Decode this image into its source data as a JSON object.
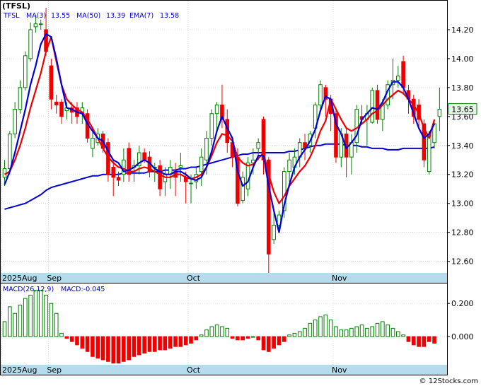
{
  "chart_data": [
    {
      "type": "candlestick",
      "ticker": "(TFSL)",
      "legend": {
        "ticker": "TFSL",
        "ma3_label": "MA(3)",
        "ma3_value": "13.55",
        "ma50_label": "MA(50)",
        "ma50_value": "13.39",
        "ema7_label": "EMA(7)",
        "ema7_value": "13.58"
      },
      "last_price": "13.65",
      "ylim": [
        12.52,
        14.4
      ],
      "yticks": [
        "14.20",
        "14.00",
        "13.80",
        "13.60",
        "13.40",
        "13.20",
        "13.00",
        "12.80",
        "12.60"
      ],
      "xlabels": [
        {
          "label": "2025Aug",
          "index": 0
        },
        {
          "label": "Sep",
          "index": 9
        },
        {
          "label": "Oct",
          "index": 36
        },
        {
          "label": "Nov",
          "index": 64
        }
      ],
      "candles": [
        [
          13.18,
          13.24,
          13.12,
          13.3
        ],
        [
          13.24,
          13.48,
          13.2,
          13.5
        ],
        [
          13.48,
          13.65,
          13.45,
          13.7
        ],
        [
          13.65,
          13.8,
          13.62,
          13.85
        ],
        [
          13.8,
          14.02,
          13.78,
          14.05
        ],
        [
          14.0,
          14.2,
          13.98,
          14.25
        ],
        [
          14.22,
          14.24,
          14.18,
          14.3
        ],
        [
          14.24,
          14.24,
          14.2,
          14.27
        ],
        [
          14.2,
          14.05,
          14.02,
          14.35
        ],
        [
          13.95,
          13.72,
          13.65,
          14.0
        ],
        [
          13.7,
          13.68,
          13.62,
          13.75
        ],
        [
          13.7,
          13.6,
          13.55,
          13.72
        ],
        [
          13.64,
          13.66,
          13.58,
          13.7
        ],
        [
          13.66,
          13.63,
          13.55,
          13.7
        ],
        [
          13.66,
          13.6,
          13.55,
          13.7
        ],
        [
          13.62,
          13.66,
          13.55,
          13.7
        ],
        [
          13.62,
          13.45,
          13.42,
          13.65
        ],
        [
          13.38,
          13.45,
          13.32,
          13.5
        ],
        [
          13.42,
          13.48,
          13.4,
          13.52
        ],
        [
          13.48,
          13.38,
          13.35,
          13.5
        ],
        [
          13.42,
          13.2,
          13.15,
          13.45
        ],
        [
          13.25,
          13.18,
          13.05,
          13.3
        ],
        [
          13.18,
          13.16,
          13.12,
          13.22
        ],
        [
          13.2,
          13.3,
          13.15,
          13.38
        ],
        [
          13.38,
          13.2,
          13.15,
          13.42
        ],
        [
          13.25,
          13.26,
          13.15,
          13.3
        ],
        [
          13.26,
          13.35,
          13.2,
          13.4
        ],
        [
          13.35,
          13.3,
          13.28,
          13.38
        ],
        [
          13.32,
          13.22,
          13.18,
          13.36
        ],
        [
          13.25,
          13.25,
          13.15,
          13.28
        ],
        [
          13.26,
          13.1,
          13.05,
          13.3
        ],
        [
          13.15,
          13.2,
          13.05,
          13.25
        ],
        [
          13.2,
          13.25,
          13.1,
          13.3
        ],
        [
          13.22,
          13.18,
          13.05,
          13.28
        ],
        [
          13.25,
          13.26,
          13.15,
          13.35
        ],
        [
          13.18,
          13.15,
          13.0,
          13.22
        ],
        [
          13.14,
          13.14,
          13.0,
          13.2
        ],
        [
          13.15,
          13.2,
          13.1,
          13.25
        ],
        [
          13.22,
          13.32,
          13.12,
          13.38
        ],
        [
          13.3,
          13.45,
          13.2,
          13.5
        ],
        [
          13.45,
          13.62,
          13.4,
          13.65
        ],
        [
          13.62,
          13.68,
          13.5,
          13.7
        ],
        [
          13.68,
          13.58,
          13.52,
          13.82
        ],
        [
          13.58,
          13.42,
          13.35,
          13.65
        ],
        [
          13.42,
          13.32,
          13.25,
          13.45
        ],
        [
          13.32,
          13.0,
          12.98,
          13.38
        ],
        [
          13.02,
          13.18,
          13.0,
          13.22
        ],
        [
          13.1,
          13.28,
          13.05,
          13.32
        ],
        [
          13.28,
          13.3,
          13.2,
          13.38
        ],
        [
          13.38,
          13.42,
          13.3,
          13.45
        ],
        [
          13.58,
          13.3,
          13.2,
          13.6
        ],
        [
          13.3,
          12.65,
          12.52,
          13.32
        ],
        [
          12.75,
          12.85,
          12.72,
          12.95
        ],
        [
          12.85,
          12.92,
          12.8,
          12.95
        ],
        [
          12.95,
          13.22,
          12.9,
          13.25
        ],
        [
          13.22,
          13.3,
          13.15,
          13.35
        ],
        [
          13.25,
          13.32,
          13.2,
          13.38
        ],
        [
          13.32,
          13.42,
          13.25,
          13.45
        ],
        [
          13.42,
          13.38,
          13.3,
          13.48
        ],
        [
          13.4,
          13.48,
          13.35,
          13.5
        ],
        [
          13.52,
          13.68,
          13.45,
          13.7
        ],
        [
          13.68,
          13.82,
          13.65,
          13.85
        ],
        [
          13.8,
          13.72,
          13.6,
          13.82
        ],
        [
          13.72,
          13.62,
          13.5,
          13.75
        ],
        [
          13.62,
          13.32,
          13.28,
          13.65
        ],
        [
          13.32,
          13.48,
          13.25,
          13.52
        ],
        [
          13.48,
          13.32,
          13.18,
          13.52
        ],
        [
          13.32,
          13.42,
          13.2,
          13.48
        ],
        [
          13.42,
          13.65,
          13.35,
          13.68
        ],
        [
          13.6,
          13.58,
          13.55,
          13.68
        ],
        [
          13.58,
          13.62,
          13.4,
          13.68
        ],
        [
          13.56,
          13.78,
          13.55,
          13.8
        ],
        [
          13.78,
          13.58,
          13.55,
          13.82
        ],
        [
          13.58,
          13.68,
          13.5,
          13.72
        ],
        [
          13.68,
          13.82,
          13.65,
          13.85
        ],
        [
          13.82,
          13.85,
          13.72,
          14.0
        ],
        [
          13.85,
          13.88,
          13.8,
          13.95
        ],
        [
          13.98,
          13.8,
          13.75,
          14.02
        ],
        [
          13.78,
          13.72,
          13.62,
          13.82
        ],
        [
          13.72,
          13.6,
          13.55,
          13.75
        ],
        [
          13.68,
          13.58,
          13.52,
          13.72
        ],
        [
          13.55,
          13.3,
          13.25,
          13.58
        ],
        [
          13.22,
          13.48,
          13.2,
          13.5
        ],
        [
          13.42,
          13.55,
          13.38,
          13.58
        ],
        [
          13.6,
          13.65,
          13.5,
          13.8
        ]
      ],
      "ma3": [
        13.13,
        13.22,
        13.35,
        13.5,
        13.65,
        13.82,
        13.95,
        14.1,
        14.17,
        14.15,
        14.0,
        13.82,
        13.66,
        13.65,
        13.63,
        13.62,
        13.55,
        13.5,
        13.45,
        13.43,
        13.36,
        13.3,
        13.28,
        13.22,
        13.23,
        13.25,
        13.28,
        13.3,
        13.28,
        13.24,
        13.22,
        13.2,
        13.2,
        13.22,
        13.22,
        13.2,
        13.17,
        13.16,
        13.18,
        13.25,
        13.36,
        13.5,
        13.6,
        13.52,
        13.45,
        13.22,
        13.12,
        13.15,
        13.25,
        13.33,
        13.33,
        13.12,
        12.95,
        12.8,
        12.99,
        13.13,
        13.25,
        13.32,
        13.37,
        13.43,
        13.51,
        13.64,
        13.74,
        13.72,
        13.55,
        13.48,
        13.38,
        13.42,
        13.47,
        13.58,
        13.62,
        13.66,
        13.65,
        13.7,
        13.78,
        13.84,
        13.84,
        13.8,
        13.72,
        13.62,
        13.52,
        13.45,
        13.48,
        13.55
      ],
      "ema7": [
        13.2,
        13.22,
        13.3,
        13.4,
        13.52,
        13.66,
        13.78,
        13.9,
        14.05,
        14.15,
        13.98,
        13.82,
        13.72,
        13.68,
        13.65,
        13.63,
        13.58,
        13.52,
        13.45,
        13.38,
        13.32,
        13.28,
        13.25,
        13.24,
        13.22,
        13.22,
        13.24,
        13.25,
        13.24,
        13.22,
        13.2,
        13.18,
        13.18,
        13.2,
        13.2,
        13.18,
        13.17,
        13.18,
        13.2,
        13.25,
        13.33,
        13.42,
        13.48,
        13.47,
        13.43,
        13.32,
        13.28,
        13.26,
        13.27,
        13.31,
        13.35,
        13.2,
        13.08,
        13.0,
        13.05,
        13.12,
        13.17,
        13.22,
        13.26,
        13.32,
        13.4,
        13.5,
        13.57,
        13.72,
        13.65,
        13.58,
        13.52,
        13.5,
        13.52,
        13.55,
        13.58,
        13.62,
        13.64,
        13.68,
        13.72,
        13.75,
        13.78,
        13.76,
        13.72,
        13.68,
        13.62,
        13.52,
        13.45,
        13.58
      ],
      "ma50": [
        12.96,
        12.97,
        12.98,
        12.99,
        13.0,
        13.02,
        13.04,
        13.06,
        13.09,
        13.11,
        13.12,
        13.13,
        13.14,
        13.15,
        13.16,
        13.17,
        13.18,
        13.19,
        13.19,
        13.2,
        13.2,
        13.2,
        13.2,
        13.21,
        13.21,
        13.21,
        13.21,
        13.21,
        13.22,
        13.22,
        13.22,
        13.23,
        13.23,
        13.23,
        13.24,
        13.24,
        13.25,
        13.25,
        13.26,
        13.27,
        13.28,
        13.29,
        13.3,
        13.31,
        13.32,
        13.33,
        13.34,
        13.34,
        13.35,
        13.35,
        13.35,
        13.35,
        13.35,
        13.35,
        13.35,
        13.36,
        13.36,
        13.37,
        13.38,
        13.39,
        13.4,
        13.4,
        13.41,
        13.41,
        13.41,
        13.41,
        13.4,
        13.4,
        13.4,
        13.39,
        13.39,
        13.38,
        13.38,
        13.38,
        13.37,
        13.37,
        13.37,
        13.38,
        13.38,
        13.38,
        13.38,
        13.38,
        13.38,
        13.39
      ]
    },
    {
      "type": "bar",
      "label": "MACD(26,12,9)",
      "value_label": "MACD:-0.045",
      "ylim": [
        -0.17,
        0.32
      ],
      "yticks": [
        "0.200",
        "0.000"
      ],
      "xlabels": [
        {
          "label": "2025Aug",
          "index": 0
        },
        {
          "label": "Sep",
          "index": 9
        },
        {
          "label": "Oct",
          "index": 36
        },
        {
          "label": "Nov",
          "index": 64
        }
      ],
      "values": [
        0.09,
        0.18,
        0.14,
        0.19,
        0.23,
        0.25,
        0.28,
        0.28,
        0.25,
        0.2,
        0.14,
        0.02,
        -0.01,
        -0.03,
        -0.05,
        -0.07,
        -0.09,
        -0.12,
        -0.13,
        -0.14,
        -0.15,
        -0.16,
        -0.16,
        -0.15,
        -0.14,
        -0.12,
        -0.11,
        -0.1,
        -0.09,
        -0.09,
        -0.08,
        -0.08,
        -0.07,
        -0.06,
        -0.06,
        -0.05,
        -0.04,
        -0.02,
        0.01,
        0.04,
        0.06,
        0.07,
        0.06,
        0.05,
        -0.01,
        -0.02,
        -0.02,
        -0.01,
        0.0,
        -0.02,
        -0.08,
        -0.09,
        -0.07,
        -0.05,
        -0.03,
        0.01,
        0.02,
        0.03,
        0.05,
        0.08,
        0.1,
        0.12,
        0.13,
        0.1,
        0.06,
        0.04,
        0.04,
        0.05,
        0.06,
        0.07,
        0.05,
        0.06,
        0.08,
        0.09,
        0.07,
        0.05,
        0.03,
        0.01,
        -0.03,
        -0.05,
        -0.06,
        -0.06,
        -0.03,
        -0.04
      ]
    }
  ],
  "footer": {
    "credit": "© 12Stocks.com"
  },
  "colors": {
    "up": "#008000",
    "up_fill": "#ffffff",
    "down": "#ee0000",
    "ma3": "#0000dd",
    "ema7": "#ee0000",
    "ma50": "#0000dd",
    "axis_band": "#b4dced",
    "grid": "#c8c8c8"
  }
}
